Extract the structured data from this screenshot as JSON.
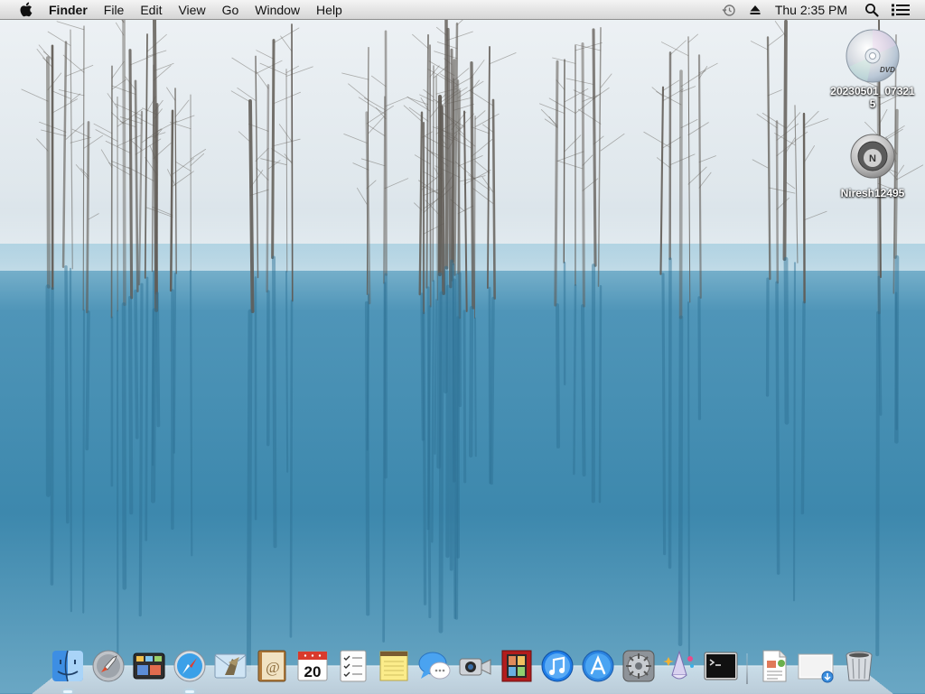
{
  "menubar": {
    "apple_icon": "apple-icon",
    "app_name": "Finder",
    "menus": [
      "File",
      "Edit",
      "View",
      "Go",
      "Window",
      "Help"
    ],
    "status_icons": [
      "time-machine-icon",
      "eject-icon"
    ],
    "clock": "Thu 2:35 PM",
    "right_icons": [
      "spotlight-icon",
      "notification-center-icon"
    ]
  },
  "desktop": {
    "wallpaper": "snowy-forest-frozen-lake",
    "icons": [
      {
        "label": "20230501_073215",
        "icon": "dvd-disc-icon"
      },
      {
        "label": "Niresh12495",
        "icon": "niresh-disk-icon"
      }
    ]
  },
  "dock": {
    "apps": [
      {
        "name": "Finder",
        "icon": "finder-icon"
      },
      {
        "name": "Launchpad",
        "icon": "launchpad-icon"
      },
      {
        "name": "Mission Control",
        "icon": "mission-control-icon"
      },
      {
        "name": "Safari",
        "icon": "safari-icon"
      },
      {
        "name": "Mail",
        "icon": "mail-icon"
      },
      {
        "name": "Contacts",
        "icon": "contacts-icon"
      },
      {
        "name": "Calendar",
        "icon": "calendar-icon",
        "day": "20"
      },
      {
        "name": "Reminders",
        "icon": "reminders-icon"
      },
      {
        "name": "Notes",
        "icon": "notes-icon"
      },
      {
        "name": "Messages",
        "icon": "messages-icon"
      },
      {
        "name": "FaceTime",
        "icon": "facetime-icon"
      },
      {
        "name": "Photo Booth",
        "icon": "photo-booth-icon"
      },
      {
        "name": "iTunes",
        "icon": "itunes-icon"
      },
      {
        "name": "App Store",
        "icon": "app-store-icon"
      },
      {
        "name": "System Preferences",
        "icon": "system-preferences-icon"
      },
      {
        "name": "Wizard",
        "icon": "wizard-icon"
      },
      {
        "name": "Terminal",
        "icon": "terminal-icon"
      }
    ],
    "docs": [
      {
        "name": "Document",
        "icon": "document-icon"
      },
      {
        "name": "Downloads",
        "icon": "downloads-stack-icon"
      },
      {
        "name": "Trash",
        "icon": "trash-icon"
      }
    ]
  }
}
